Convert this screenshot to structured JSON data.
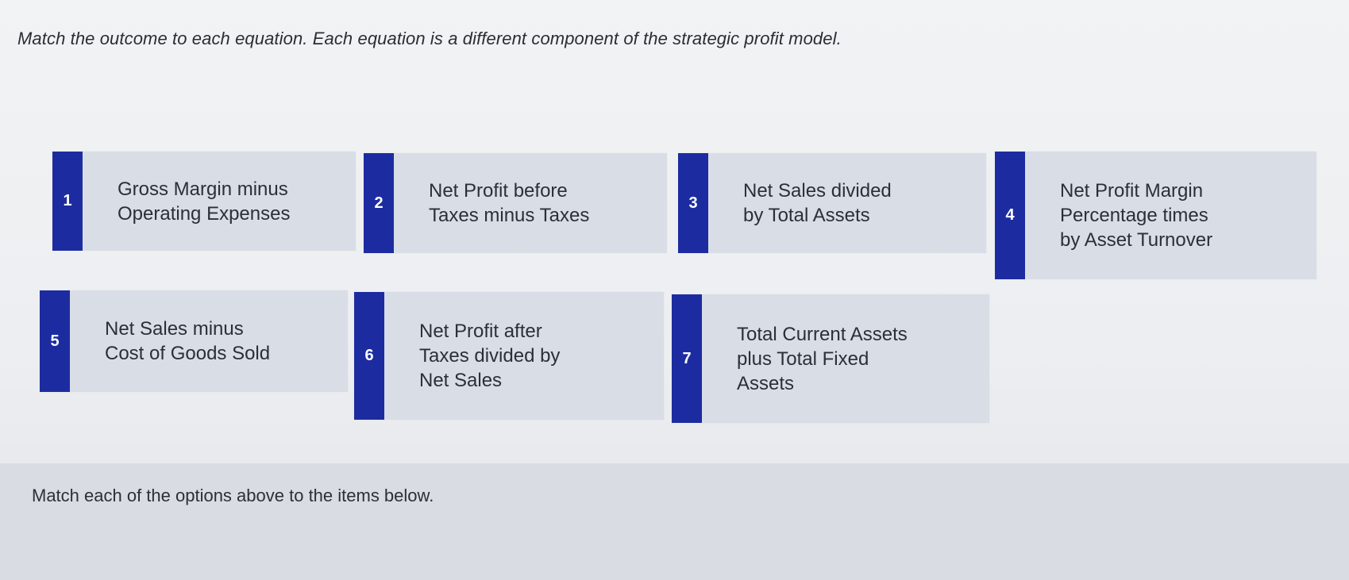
{
  "instructions": "Match the outcome to each equation. Each equation is a different component of the strategic profit model.",
  "cards": [
    {
      "number": "1",
      "text": "Gross Margin minus\nOperating Expenses"
    },
    {
      "number": "2",
      "text": "Net Profit before\nTaxes minus Taxes"
    },
    {
      "number": "3",
      "text": "Net Sales divided\nby Total Assets"
    },
    {
      "number": "4",
      "text": "Net Profit Margin\nPercentage times\nby Asset Turnover"
    },
    {
      "number": "5",
      "text": "Net Sales minus\nCost of Goods Sold"
    },
    {
      "number": "6",
      "text": "Net Profit after\nTaxes divided by\nNet Sales"
    },
    {
      "number": "7",
      "text": "Total Current Assets\nplus Total Fixed\nAssets"
    }
  ],
  "match_prompt": "Match each of the options above to the items below.",
  "colors": {
    "number_tab": "#1c2ca0",
    "card_background": "#d9dde6",
    "text": "#2b2f36"
  }
}
